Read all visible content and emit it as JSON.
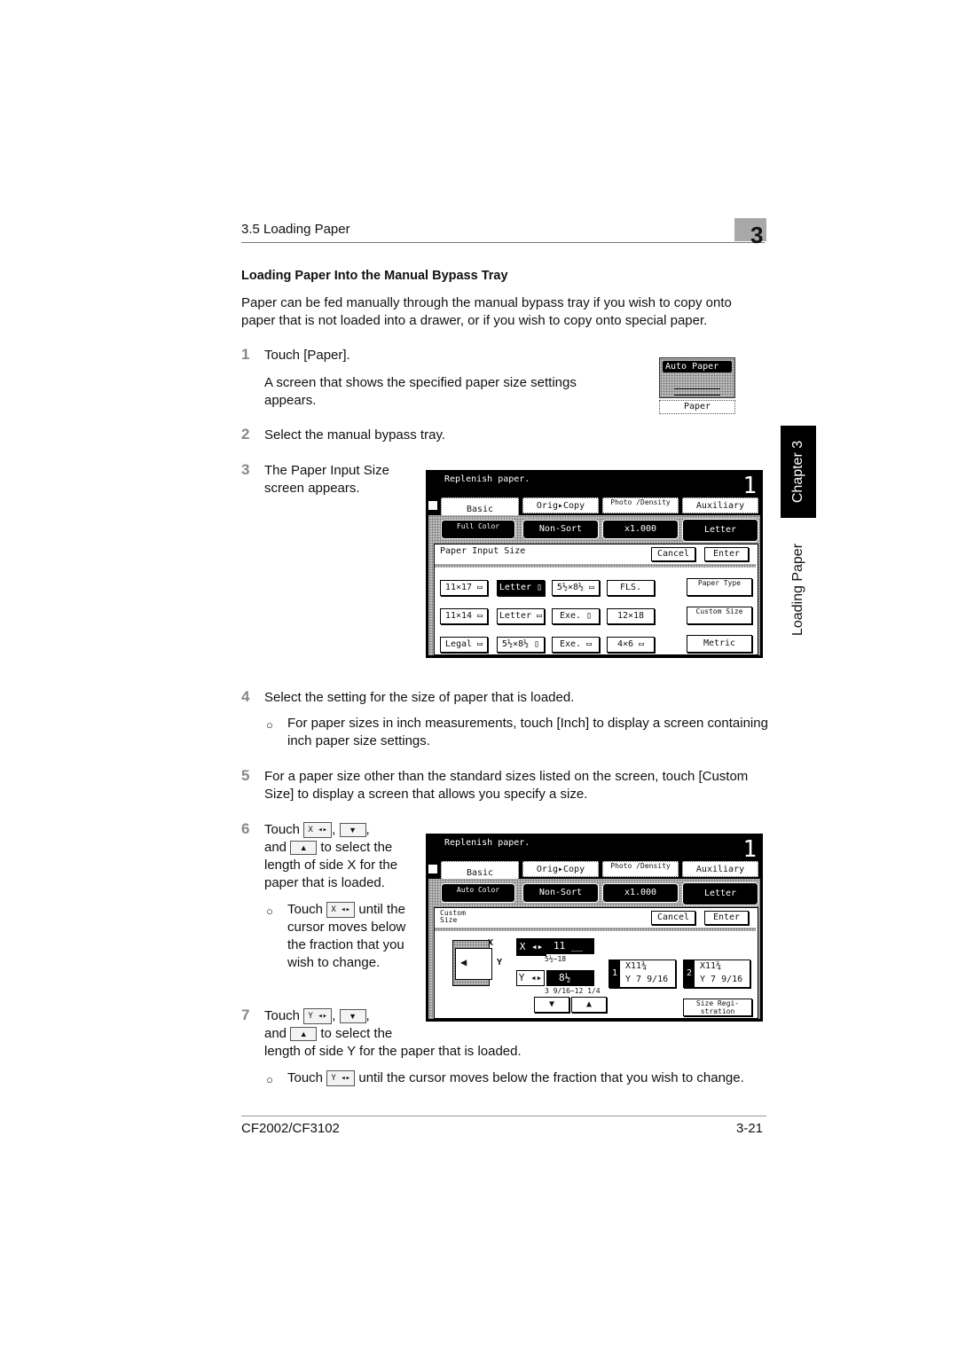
{
  "header": {
    "section": "3.5 Loading Paper",
    "chapter_number": "3"
  },
  "heading": "Loading Paper Into the Manual Bypass Tray",
  "intro": "Paper can be fed manually through the manual bypass tray if you wish to copy onto paper that is not loaded into a drawer, or if you wish to copy onto special paper.",
  "side_tab": {
    "chapter": "Chapter 3",
    "title": "Loading Paper"
  },
  "steps": [
    {
      "num": "1",
      "text": "Touch [Paper].",
      "sub": "A screen that shows the specified paper size settings appears."
    },
    {
      "num": "2",
      "text": "Select the manual bypass tray."
    },
    {
      "num": "3",
      "text": "The Paper Input Size screen appears."
    },
    {
      "num": "4",
      "text": "Select the setting for the size of paper that is loaded.",
      "bullet": "For paper sizes in inch measurements, touch [Inch] to display a screen containing inch paper size settings."
    },
    {
      "num": "5",
      "text": "For a paper size other than the standard sizes listed on the screen, touch [Custom Size] to display a screen that allows you specify a size."
    },
    {
      "num": "6",
      "text_a": "Touch",
      "text_b": ",",
      "text_c": ",",
      "text_d": "and",
      "text_e": "to select the length of side X for the paper that is loaded.",
      "bullet_a": "Touch",
      "bullet_b": "until the cursor moves below the fraction that you wish to change."
    },
    {
      "num": "7",
      "text_a": "Touch",
      "text_b": ",",
      "text_c": ",",
      "text_d": "and",
      "text_e": "to select the",
      "text_f": "length of side Y for the paper that is loaded.",
      "bullet_a": "Touch",
      "bullet_b": "until the cursor moves below the fraction that you wish to change."
    }
  ],
  "inline_icons": {
    "x_key": "X ◂▸",
    "y_key": "Y ◂▸",
    "down": "▼",
    "up": "▲"
  },
  "auto_paper_button": {
    "top": "Auto Paper",
    "bottom": "Paper"
  },
  "screen1": {
    "message": "Replenish paper.",
    "count": "1",
    "tabs": [
      "Basic",
      "Orig▸Copy",
      "Photo /Density",
      "Auxiliary"
    ],
    "func_buttons": [
      "Full Color",
      "Non-Sort",
      "x1.000",
      "Letter"
    ],
    "panel_title": "Paper Input Size",
    "cancel": "Cancel",
    "enter": "Enter",
    "sizes": [
      [
        "11×17 ▭",
        "Letter ▯",
        "5½×8½ ▭",
        "FLS."
      ],
      [
        "11×14 ▭",
        "Letter ▭",
        "Exe. ▯",
        "12×18"
      ],
      [
        "Legal ▭",
        "5½×8½ ▯",
        "Exe. ▭",
        "4×6 ▭"
      ]
    ],
    "selected_size": "Letter ▯",
    "side_buttons": [
      "Paper Type",
      "Custom Size",
      "Metric"
    ]
  },
  "screen2": {
    "message": "Replenish paper.",
    "count": "1",
    "tabs": [
      "Basic",
      "Orig▸Copy",
      "Photo /Density",
      "Auxiliary"
    ],
    "func_buttons": [
      "Auto Color",
      "Non-Sort",
      "x1.000",
      "Letter"
    ],
    "panel_title": "Custom Size",
    "cancel": "Cancel",
    "enter": "Enter",
    "x_label": "X",
    "y_label": "Y",
    "x_key": "X ◂▸",
    "y_key": "Y ◂▸",
    "x_value": "11 __",
    "y_value": "8½",
    "x_range": "5½~18",
    "y_range": "3 9/16~12 1/4",
    "memory1": {
      "num": "1",
      "x": "X11¾",
      "y": "Y 7 9/16"
    },
    "memory2": {
      "num": "2",
      "x": "X11¾",
      "y": "Y 7 9/16"
    },
    "size_registration": "Size Regi- stration"
  },
  "footer": {
    "model": "CF2002/CF3102",
    "page": "3-21"
  }
}
